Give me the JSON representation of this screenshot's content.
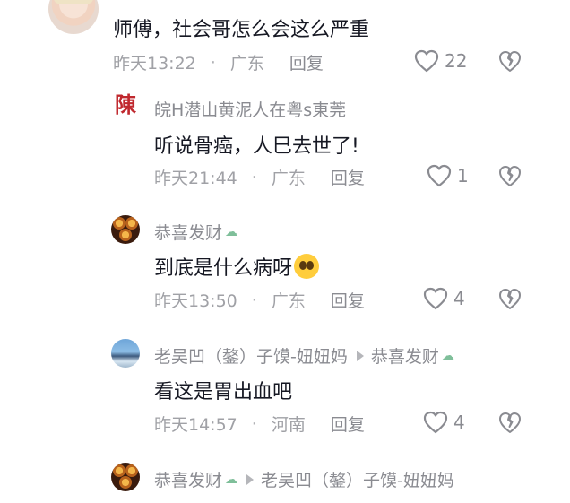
{
  "colors": {
    "text": "#161823",
    "secondary": "#8a8b91",
    "muted": "#a0a1a6",
    "accent_seal": "#c0282e"
  },
  "top_comment": {
    "text": "师傅，社会哥怎么会这么严重",
    "time": "昨天13:22",
    "location": "广东",
    "reply_label": "回复",
    "likes": "22"
  },
  "replies": [
    {
      "author": "皖H潜山黄泥人在粤s東莞",
      "text": "听说骨癌，人巳去世了!",
      "time": "昨天21:44",
      "location": "广东",
      "reply_label": "回复",
      "likes": "1"
    },
    {
      "author": "恭喜发财",
      "text": "到底是什么病呀",
      "time": "昨天13:50",
      "location": "广东",
      "reply_label": "回复",
      "likes": "4"
    },
    {
      "author": "老吴凹（鏊）子馍-妞妞妈",
      "reply_to": "恭喜发财",
      "text": "看这是胃出血吧",
      "time": "昨天14:57",
      "location": "河南",
      "reply_label": "回复",
      "likes": "4"
    },
    {
      "author": "恭喜发财",
      "reply_to": "老吴凹（鏊）子馍-妞妞妈"
    }
  ],
  "icons": {
    "like": "heart-outline-icon",
    "dislike": "broken-heart-icon"
  }
}
